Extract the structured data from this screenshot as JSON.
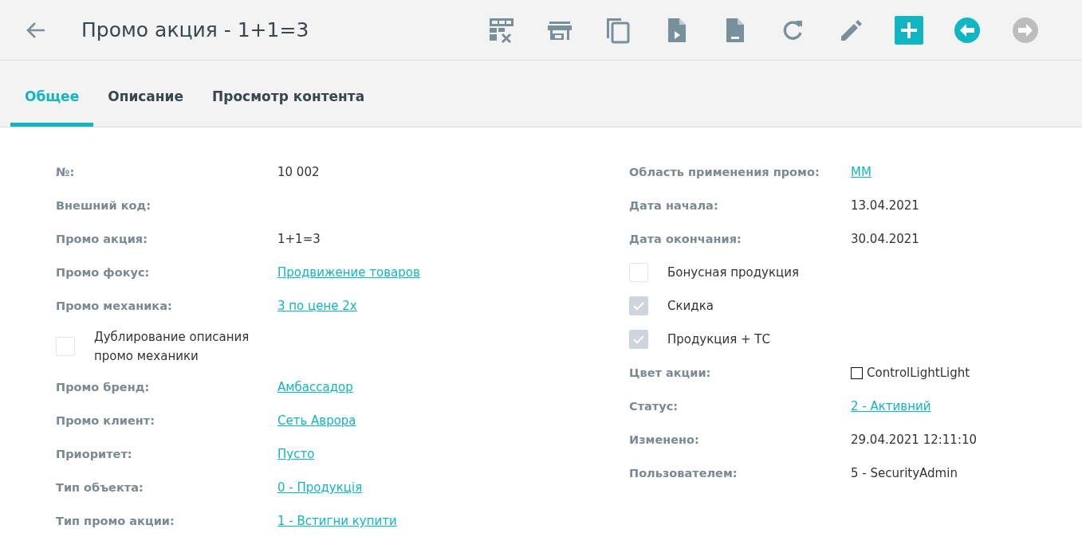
{
  "header": {
    "title": "Промо акция - 1+1=3"
  },
  "toolbar": [
    {
      "kind": "table-delete",
      "disabled": false
    },
    {
      "kind": "store",
      "disabled": false
    },
    {
      "kind": "copy",
      "disabled": false
    },
    {
      "kind": "file-play",
      "disabled": false
    },
    {
      "kind": "file-minus",
      "disabled": false
    },
    {
      "kind": "refresh",
      "disabled": false
    },
    {
      "kind": "edit",
      "disabled": false
    },
    {
      "kind": "add",
      "disabled": false
    },
    {
      "kind": "prev",
      "disabled": false
    },
    {
      "kind": "next",
      "disabled": true
    }
  ],
  "tabs": [
    {
      "label": "Общее",
      "selected": true
    },
    {
      "label": "Описание",
      "selected": false
    },
    {
      "label": "Просмотр контента",
      "selected": false
    }
  ],
  "left_fields": [
    {
      "kind": "text",
      "label": "№:",
      "value": "10 002"
    },
    {
      "kind": "text",
      "label": "Внешний код:"
    },
    {
      "kind": "text",
      "label": "Промо акция:",
      "value": "1+1=3"
    },
    {
      "kind": "link",
      "label": "Промо фокус:",
      "value": "Продвижение товаров"
    },
    {
      "kind": "link",
      "label": "Промо механика:",
      "value": "3 по цене 2х"
    },
    {
      "kind": "checkbox",
      "label": "Дублирование описания промо механики",
      "checked": false,
      "disabled": false
    },
    {
      "kind": "link",
      "label": "Промо бренд:",
      "value": "Амбассадор"
    },
    {
      "kind": "link",
      "label": "Промо клиент:",
      "value": "Сеть Аврора"
    },
    {
      "kind": "link",
      "label": "Приоритет:",
      "value": "Пусто"
    },
    {
      "kind": "link",
      "label": "Тип объекта:",
      "value": "0 - Продукція"
    },
    {
      "kind": "link",
      "label": "Тип промо акции:",
      "value": "1 - Встигни купити"
    }
  ],
  "right_fields": [
    {
      "kind": "link",
      "label": "Область применения промо:",
      "value": "ММ"
    },
    {
      "kind": "text",
      "label": "Дата начала:",
      "value": "13.04.2021"
    },
    {
      "kind": "text",
      "label": "Дата окончания:",
      "value": "30.04.2021"
    },
    {
      "kind": "checkbox",
      "label": "Бонусная продукция",
      "checked": false,
      "disabled": false
    },
    {
      "kind": "checkbox",
      "label": "Скидка",
      "checked": true,
      "disabled": true
    },
    {
      "kind": "checkbox",
      "label": "Продукция + ТС",
      "checked": true,
      "disabled": true
    },
    {
      "kind": "color",
      "label": "Цвет акции:",
      "value": "ControlLightLight",
      "color": "#ffffff"
    },
    {
      "kind": "link",
      "label": "Статус:",
      "value": "2 - Активний"
    },
    {
      "kind": "text",
      "label": "Изменено:",
      "value": "29.04.2021 12:11:10"
    },
    {
      "kind": "text",
      "label": "Пользователем:",
      "value": "5 - SecurityAdmin"
    }
  ]
}
